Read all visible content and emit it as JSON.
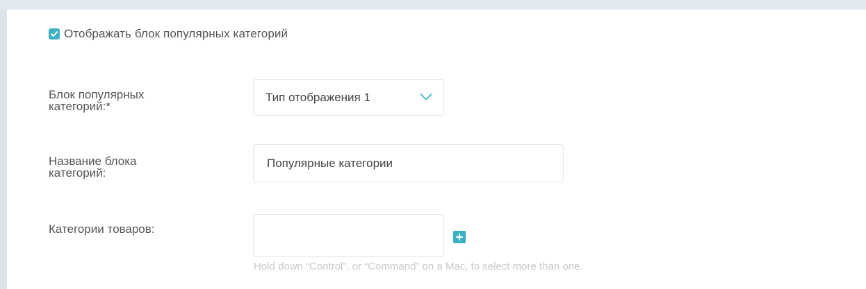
{
  "popular_block_checkbox": {
    "label": "Отображать блок популярных категорий",
    "checked": true
  },
  "fields": {
    "block_type": {
      "label_line1": "Блок популярных",
      "label_line2": "категорий:*",
      "value": "Тип отображения 1"
    },
    "block_name": {
      "label_line1": "Название блока",
      "label_line2": "категорий:",
      "value": "Популярные категории"
    },
    "product_categories": {
      "label": "Категории товаров:",
      "help_text": "Hold down “Control”, or “Command” on a Mac, to select more than one."
    }
  },
  "colors": {
    "accent": "#3cb1c3",
    "background": "#e2e9f1",
    "panel": "#ffffff"
  },
  "icons": {
    "checkbox": "check-icon",
    "select": "chevron-down-icon",
    "add": "plus-icon"
  }
}
